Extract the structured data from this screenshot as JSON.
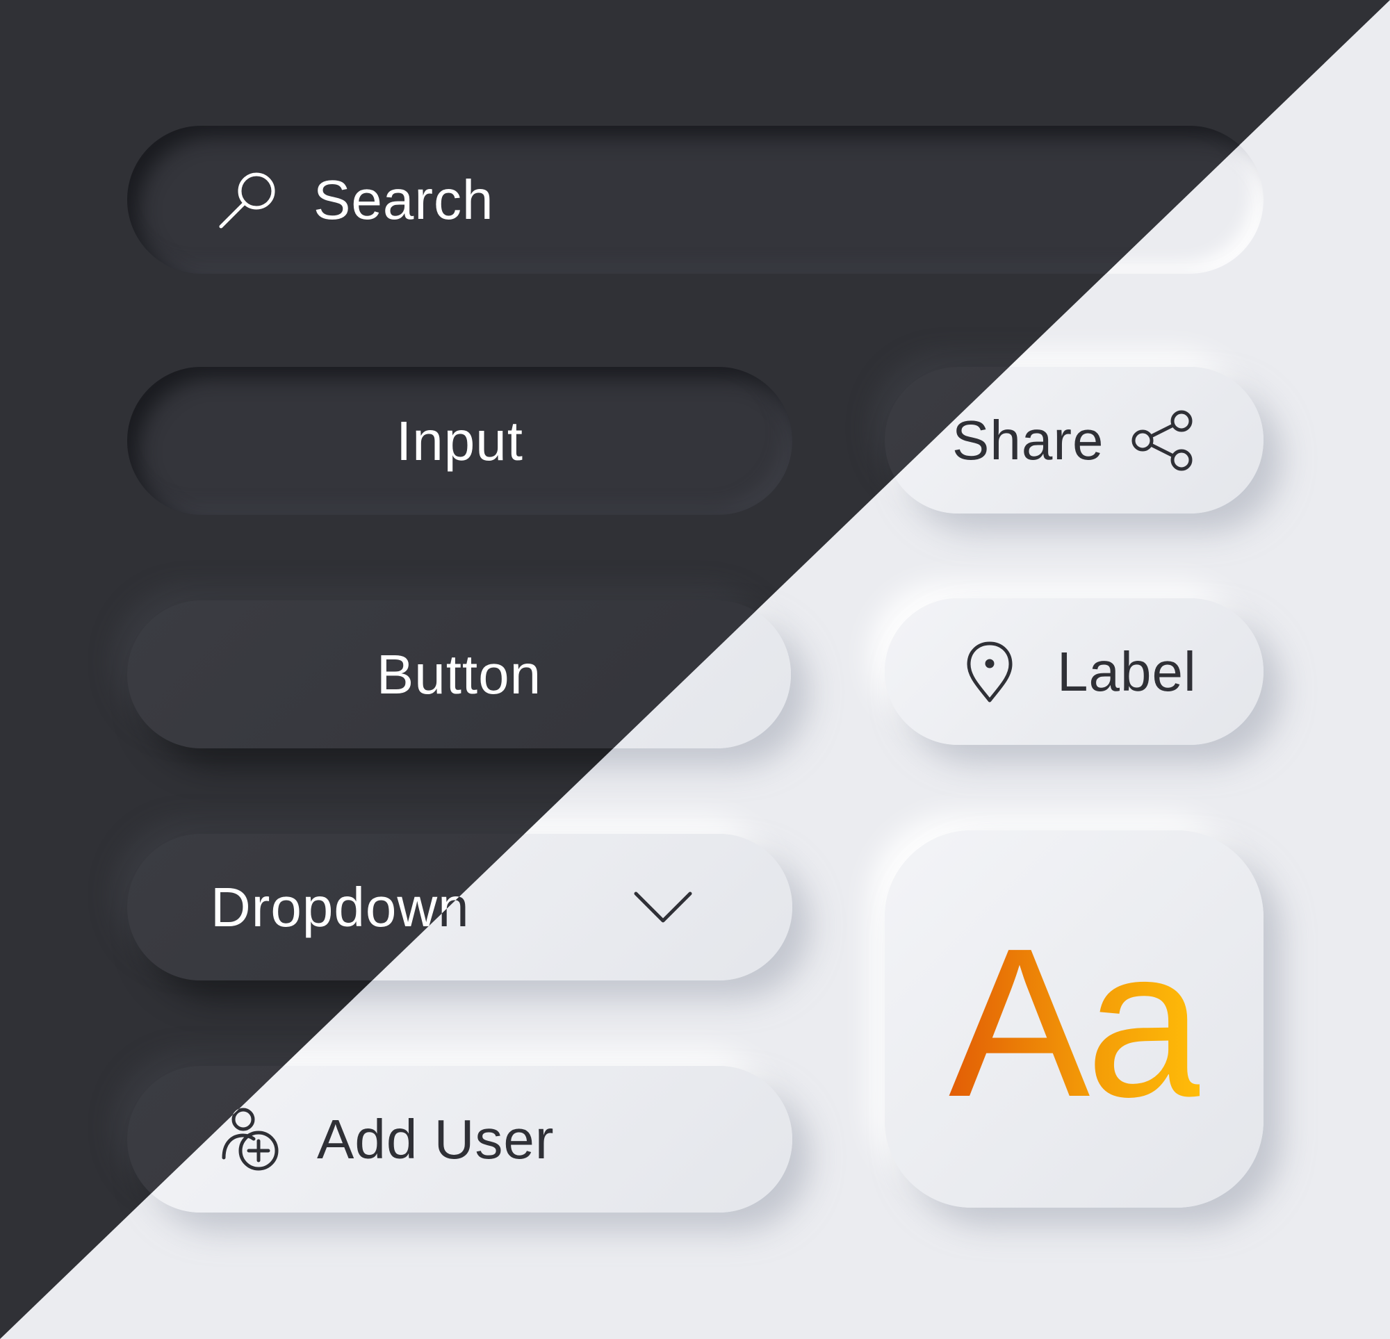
{
  "theme": {
    "dark_background": "#303136",
    "light_background": "#ebecf0",
    "dark_text": "#ffffff",
    "light_text": "#2f3036",
    "accent_gradient": [
      "#e25d06",
      "#f39a07",
      "#ffbc09"
    ]
  },
  "search": {
    "label": "Search",
    "icon": "search-icon"
  },
  "input": {
    "label": "Input"
  },
  "button": {
    "label": "Button"
  },
  "dropdown": {
    "label": "Dropdown",
    "icon": "chevron-down-icon"
  },
  "add_user": {
    "label": "Add User",
    "icon": "add-user-icon"
  },
  "share": {
    "label": "Share",
    "icon": "share-icon"
  },
  "label_chip": {
    "label": "Label",
    "icon": "location-pin-icon"
  },
  "typography": {
    "sample": "Aa"
  }
}
